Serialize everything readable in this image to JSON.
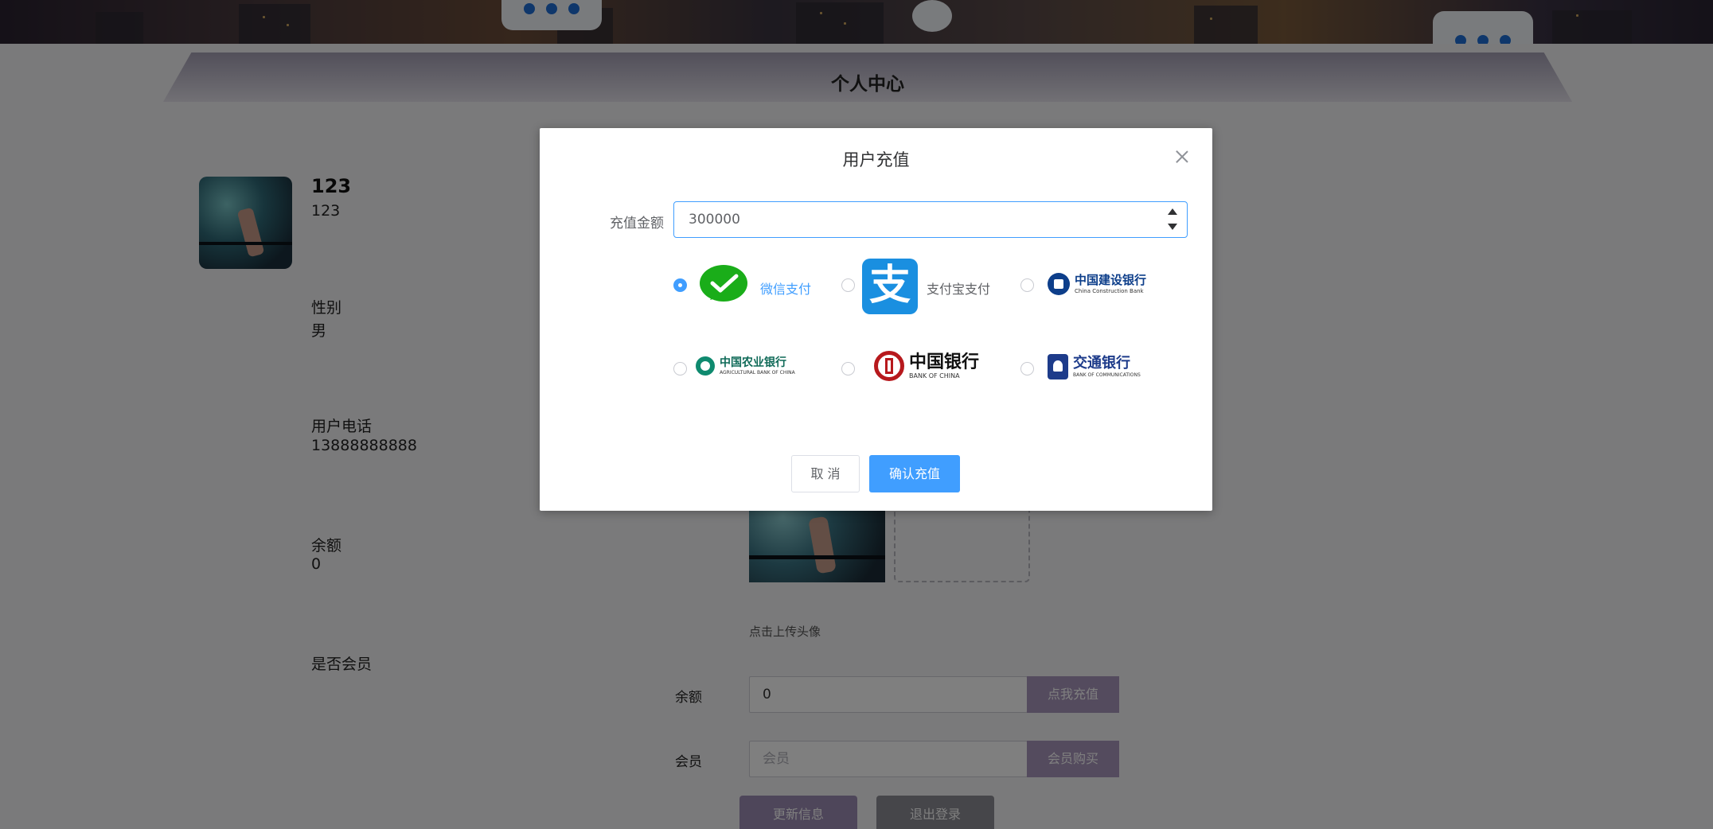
{
  "page": {
    "title": "个人中心"
  },
  "profile": {
    "username": "123",
    "username_sub": "123",
    "gender_label": "性别",
    "gender_value": "男",
    "phone_label": "用户电话",
    "phone_value": "13888888888",
    "balance_label": "余额",
    "balance_value": "0",
    "member_label": "是否会员",
    "upload_hint": "点击上传头像"
  },
  "form": {
    "balance_label": "余额",
    "balance_value": "0",
    "recharge_button": "点我充值",
    "member_label": "会员",
    "member_placeholder": "会员",
    "member_buy_button": "会员购买",
    "update_button": "更新信息",
    "logout_button": "退出登录"
  },
  "dialog": {
    "title": "用户充值",
    "amount_label": "充值金额",
    "amount_value": "300000",
    "payment_methods": [
      {
        "label": "微信支付",
        "selected": true
      },
      {
        "label": "支付宝支付",
        "selected": false
      },
      {
        "label": "中国建设银行",
        "sub": "China Construction Bank",
        "selected": false
      },
      {
        "label": "中国农业银行",
        "sub": "AGRICULTURAL BANK OF CHINA",
        "selected": false
      },
      {
        "label": "中国银行",
        "sub": "BANK OF CHINA",
        "selected": false
      },
      {
        "label": "交通银行",
        "sub": "BANK OF COMMUNICATIONS",
        "selected": false
      }
    ],
    "alipay_glyph": "支",
    "cancel_button": "取 消",
    "confirm_button": "确认充值"
  },
  "colors": {
    "primary": "#409eff",
    "accent_purple": "#a896bd",
    "mask": "rgba(0,0,0,0.5)"
  }
}
